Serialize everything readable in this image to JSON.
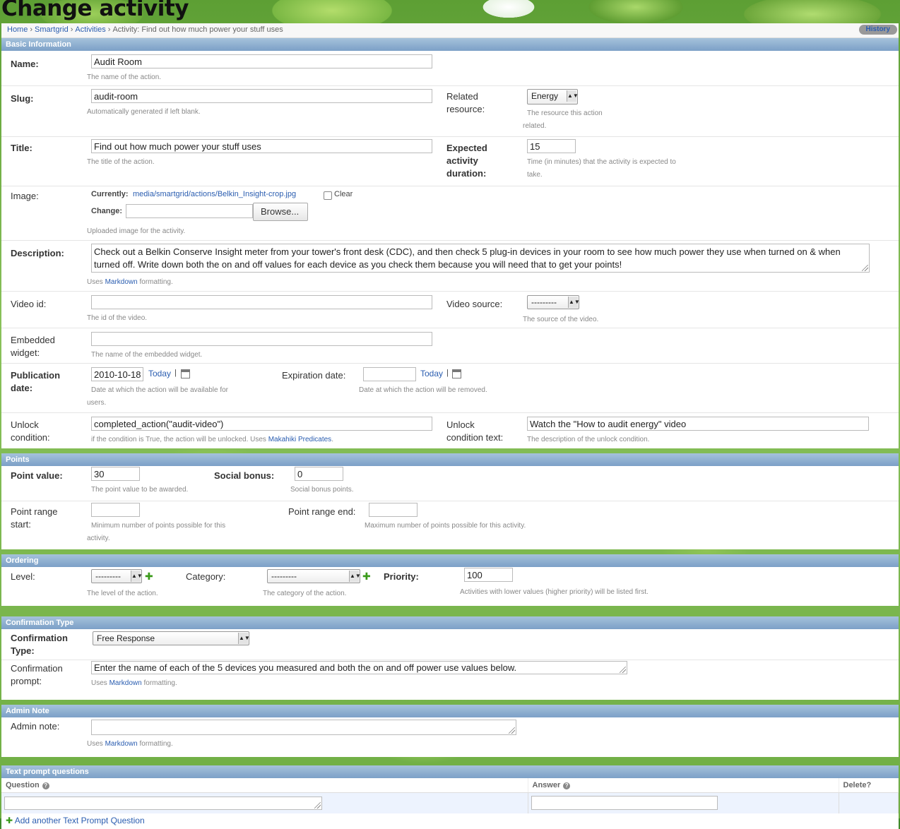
{
  "page_title": "Change activity",
  "breadcrumb": {
    "home": "Home",
    "app": "Smartgrid",
    "model": "Activities",
    "current": "Activity: Find out how much power your stuff uses",
    "sep": "›"
  },
  "history_label": "History",
  "basic": {
    "heading": "Basic Information",
    "name": {
      "label": "Name:",
      "value": "Audit Room",
      "help": "The name of the action."
    },
    "slug": {
      "label": "Slug:",
      "value": "audit-room",
      "help": "Automatically generated if left blank."
    },
    "related_resource": {
      "label1": "Related",
      "label2": "resource:",
      "value": "Energy",
      "help1": "The resource this action",
      "help2": "related."
    },
    "title": {
      "label": "Title:",
      "value": "Find out how much power your stuff uses",
      "help": "The title of the action."
    },
    "duration": {
      "label1": "Expected",
      "label2": "activity",
      "label3": "duration:",
      "value": "15",
      "help1": "Time (in minutes) that the activity is expected to",
      "help2": "take."
    },
    "image": {
      "label": "Image:",
      "currently_label": "Currently:",
      "current_path": "media/smartgrid/actions/Belkin_Insight-crop.jpg",
      "clear_label": "Clear",
      "change_label": "Change:",
      "browse_label": "Browse...",
      "help": "Uploaded image for the activity."
    },
    "description": {
      "label": "Description:",
      "value": "Check out a Belkin Conserve Insight meter from your tower's front desk (CDC), and then check 5 plug-in devices in your room to see how much power they use when turned on & when turned off. Write down both the on and off values for each device as you check them because you will need that to get your points!",
      "help_pre": "Uses",
      "help_link": "Markdown",
      "help_post": "formatting."
    },
    "video_id": {
      "label": "Video id:",
      "value": "",
      "help": "The id of the video."
    },
    "video_source": {
      "label": "Video source:",
      "value": "---------",
      "help": "The source of the video."
    },
    "embedded": {
      "label1": "Embedded",
      "label2": "widget:",
      "value": "",
      "help": "The name of the embedded widget."
    },
    "pub_date": {
      "label1": "Publication",
      "label2": "date:",
      "value": "2010-10-18",
      "today": "Today",
      "bar": "|",
      "help1": "Date at which the action will be available for",
      "help2": "users."
    },
    "exp_date": {
      "label": "Expiration date:",
      "value": "",
      "today": "Today",
      "bar": "|",
      "help": "Date at which the action will be removed."
    },
    "unlock": {
      "label1": "Unlock",
      "label2": "condition:",
      "value": "completed_action(\"audit-video\")",
      "help_pre": "if the condition is True, the action will be unlocked. Uses",
      "help_link": "Makahiki Predicates",
      "help_post": "."
    },
    "unlock_text": {
      "label1": "Unlock",
      "label2": "condition text:",
      "value": "Watch the \"How to audit energy\" video",
      "help": "The description of the unlock condition."
    }
  },
  "points": {
    "heading": "Points",
    "point_value": {
      "label": "Point value:",
      "value": "30",
      "help": "The point value to be awarded."
    },
    "social_bonus": {
      "label": "Social bonus:",
      "value": "0",
      "help": "Social bonus points."
    },
    "range_start": {
      "label1": "Point range",
      "label2": "start:",
      "value": "",
      "help1": "Minimum number of points possible for this",
      "help2": "activity."
    },
    "range_end": {
      "label": "Point range end:",
      "value": "",
      "help": "Maximum number of points possible for this activity."
    }
  },
  "ordering": {
    "heading": "Ordering",
    "level": {
      "label": "Level:",
      "value": "---------",
      "help": "The level of the action."
    },
    "category": {
      "label": "Category:",
      "value": "---------",
      "help": "The category of the action."
    },
    "priority": {
      "label": "Priority:",
      "value": "100",
      "help": "Activities with lower values (higher priority) will be listed first."
    }
  },
  "confirmation": {
    "heading": "Confirmation Type",
    "type": {
      "label1": "Confirmation",
      "label2": "Type:",
      "value": "Free Response"
    },
    "prompt": {
      "label1": "Confirmation",
      "label2": "prompt:",
      "value": "Enter the name of each of the 5 devices you measured and both the on and off power use values below.",
      "help_pre": "Uses",
      "help_link": "Markdown",
      "help_post": "formatting."
    }
  },
  "admin_note": {
    "heading": "Admin Note",
    "label": "Admin note:",
    "value": "",
    "help_pre": "Uses",
    "help_link": "Markdown",
    "help_post": "formatting."
  },
  "text_prompts": {
    "heading": "Text prompt questions",
    "col_question": "Question",
    "col_answer": "Answer",
    "col_delete": "Delete?",
    "question_value": "",
    "answer_value": "",
    "add_label": "Add another Text Prompt Question"
  }
}
